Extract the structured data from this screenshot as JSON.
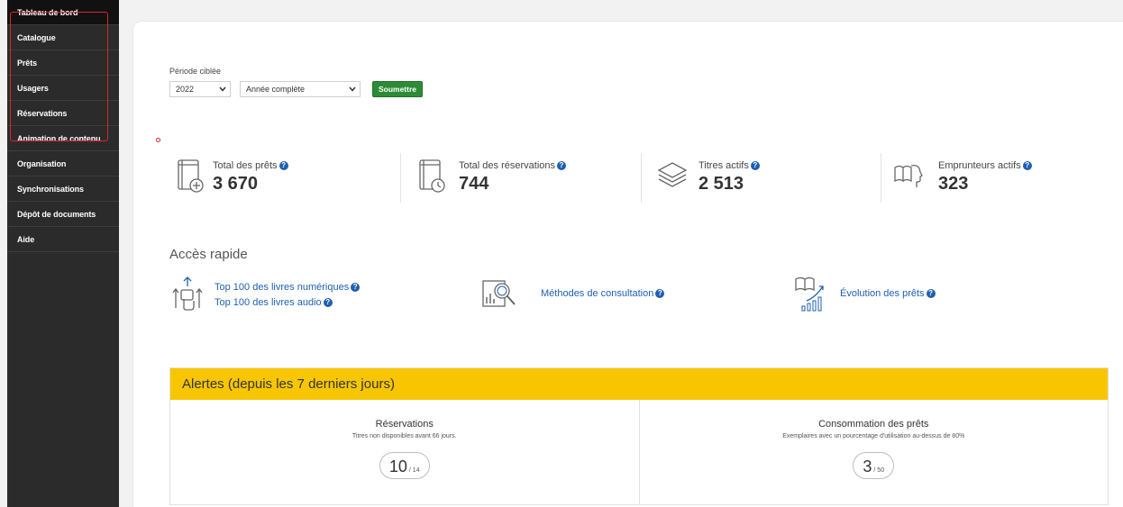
{
  "sidebar": {
    "items": [
      {
        "label": "Tableau de bord"
      },
      {
        "label": "Catalogue"
      },
      {
        "label": "Prêts"
      },
      {
        "label": "Usagers"
      },
      {
        "label": "Réservations"
      },
      {
        "label": "Animation de contenu"
      },
      {
        "label": "Organisation"
      },
      {
        "label": "Synchronisations"
      },
      {
        "label": "Dépôt de documents"
      },
      {
        "label": "Aide"
      }
    ]
  },
  "filter": {
    "label": "Période ciblée",
    "year": "2022",
    "period": "Année complète",
    "submit": "Soumettre"
  },
  "stats": [
    {
      "label": "Total des prêts",
      "value": "3 670",
      "icon": "book-plus-icon"
    },
    {
      "label": "Total des réservations",
      "value": "744",
      "icon": "book-clock-icon"
    },
    {
      "label": "Titres actifs",
      "value": "2 513",
      "icon": "layers-icon"
    },
    {
      "label": "Emprunteurs actifs",
      "value": "323",
      "icon": "reader-head-icon"
    }
  ],
  "quick_access": {
    "title": "Accès rapide",
    "top_ebooks": "Top 100 des livres numériques",
    "top_audio": "Top 100 des livres audio",
    "methods": "Méthodes de consultation",
    "evolution": "Évolution des prêts"
  },
  "alerts": {
    "title": "Alertes (depuis les 7 derniers jours)",
    "reservations": {
      "title": "Réservations",
      "subtitle": "Titres non disponibles avant 66 jours.",
      "count": "10",
      "total": "/ 14"
    },
    "consumption": {
      "title": "Consommation des prêts",
      "subtitle": "Exemplaires avec un pourcentage d'utilisation au-dessus de 80%",
      "count": "3",
      "total": "/ 50"
    }
  },
  "colors": {
    "sidebar_bg": "#2b2b2b",
    "accent_blue": "#1f5fb0",
    "submit_green": "#2d8b36",
    "alert_yellow": "#f7c600",
    "annotation_red": "#d9262f"
  }
}
